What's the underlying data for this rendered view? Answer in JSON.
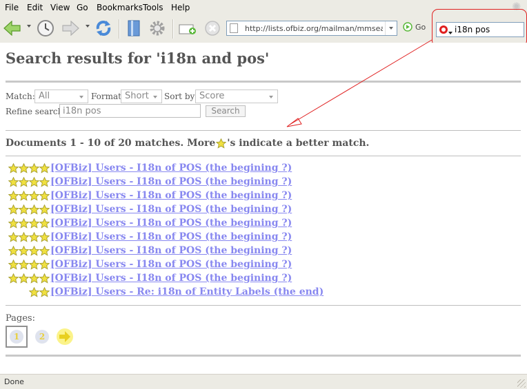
{
  "menu": [
    "File",
    "Edit",
    "View",
    "Go",
    "Bookmarks",
    "Tools",
    "Help"
  ],
  "toolbar": {
    "url": "http://lists.ofbiz.org/mailman/mmsearch/u",
    "go_label": "Go",
    "search_value": "i18n pos"
  },
  "page": {
    "title": "Search results for 'i18n and pos'",
    "match_label": "Match:",
    "match_value": "All",
    "format_label": "Format:",
    "format_value": "Short",
    "sortby_label": "Sort by:",
    "sortby_value": "Score",
    "refine_label": "Refine search:",
    "refine_value": "i18n pos",
    "search_button": "Search",
    "summary_before": "Documents 1 - 10 of 20 matches. More ",
    "summary_after": "'s indicate a better match.",
    "results": [
      {
        "stars": 4,
        "title": "[OFBiz] Users - I18n of POS (the begining ?)"
      },
      {
        "stars": 4,
        "title": "[OFBiz] Users - I18n of POS (the begining ?) "
      },
      {
        "stars": 4,
        "title": "[OFBiz] Users - I18n of POS (the begining ?) "
      },
      {
        "stars": 4,
        "title": "[OFBiz] Users - I18n of POS (the begining ?)"
      },
      {
        "stars": 4,
        "title": "[OFBiz] Users - I18n of POS (the begining ?) "
      },
      {
        "stars": 4,
        "title": "[OFBiz] Users - I18n of POS (the begining ?) "
      },
      {
        "stars": 4,
        "title": "[OFBiz] Users - I18n of POS (the begining ?) "
      },
      {
        "stars": 4,
        "title": "[OFBiz] Users - I18n of POS (the begining ?)"
      },
      {
        "stars": 4,
        "title": "[OFBiz] Users - I18n of POS (the begining ?) "
      },
      {
        "stars": 2,
        "title": "[OFBiz] Users - Re: i18n of Entity Labels (the end)"
      }
    ],
    "pages_label": "Pages:",
    "pages": [
      "1",
      "2"
    ]
  },
  "status": {
    "text": "Done"
  },
  "colors": {
    "link": "#8888f0",
    "star": "#f0e040",
    "annotation": "#e02020"
  }
}
